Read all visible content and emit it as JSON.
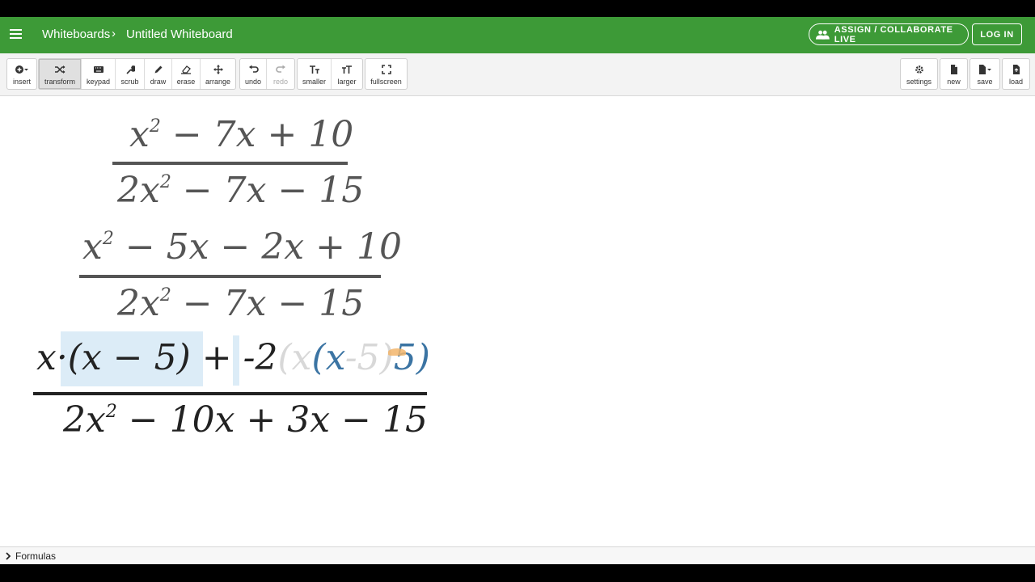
{
  "header": {
    "breadcrumb_root": "Whiteboards",
    "breadcrumb_separator": "›",
    "title": "Untitled Whiteboard",
    "collab_label": "ASSIGN / COLLABORATE LIVE",
    "login_label": "LOG IN"
  },
  "toolbar": {
    "insert": "insert",
    "transform": "transform",
    "keypad": "keypad",
    "scrub": "scrub",
    "draw": "draw",
    "erase": "erase",
    "arrange": "arrange",
    "undo": "undo",
    "redo": "redo",
    "smaller": "smaller",
    "larger": "larger",
    "fullscreen": "fullscreen",
    "settings": "settings",
    "new": "new",
    "save": "save",
    "load": "load"
  },
  "expressions": {
    "e1_num_a": "x",
    "e1_num_exp": "2",
    "e1_num_b": " − 7x + 10",
    "e1_den_a": "2x",
    "e1_den_exp": "2",
    "e1_den_b": " − 7x − 15",
    "e2_num_a": "x",
    "e2_num_exp": "2",
    "e2_num_b": " − 5x − 2x + 10",
    "e2_den_a": "2x",
    "e2_den_exp": "2",
    "e2_den_b": " − 7x − 15",
    "e3_num_part1": "x·(x − 5)",
    "e3_num_part2": " + -2",
    "e3_num_ghost": "(x",
    "e3_num_blue1": "(x",
    "e3_num_ghost2": "-5",
    "e3_num_ghost3": ")",
    "e3_num_blue2": "5)",
    "e3_den_a": "2x",
    "e3_den_exp": "2",
    "e3_den_b": " − 10x + 3x − 15"
  },
  "bottom": {
    "formulas_label": "Formulas"
  },
  "colors": {
    "header_green": "#3d9a37",
    "math_gray": "#555555",
    "math_black": "#222222",
    "blue_drag": "#3b74a3",
    "selection": "#dcecf7"
  }
}
